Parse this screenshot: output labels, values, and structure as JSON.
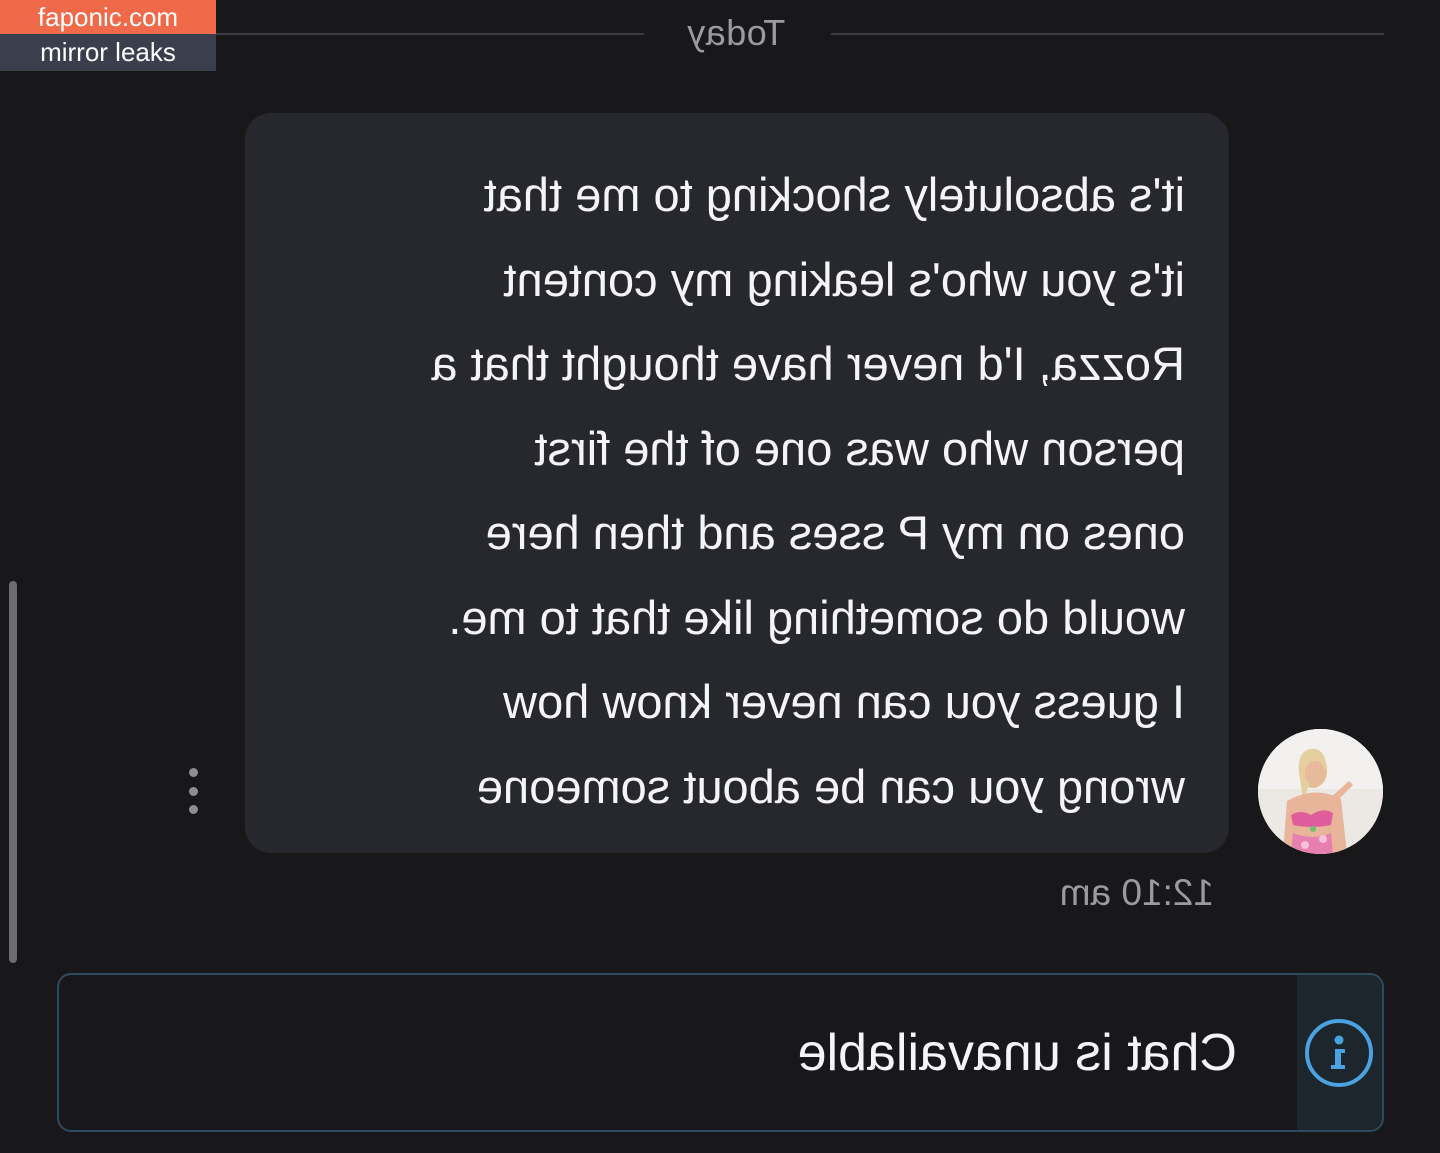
{
  "watermark": {
    "site": "faponic.com",
    "tagline": "mirror leaks"
  },
  "chat": {
    "date_divider": "Today",
    "message": {
      "text": "it's absolutely shocking to me that\nit's you who's leaking my content\nRozza, I'd never have thought that a\nperson who was one of the first\nones on my P sses and then here\nwould do something like that to me.\nI guess you can never know how\nwrong you can be about someone",
      "timestamp": "12:10 am",
      "avatar_icon": "user-avatar-photo"
    },
    "status_bar": {
      "icon": "info-icon",
      "text": "Chat is unavailable",
      "accent_color": "#4aa3e0"
    }
  },
  "icons": {
    "more": "more-options-icon"
  }
}
